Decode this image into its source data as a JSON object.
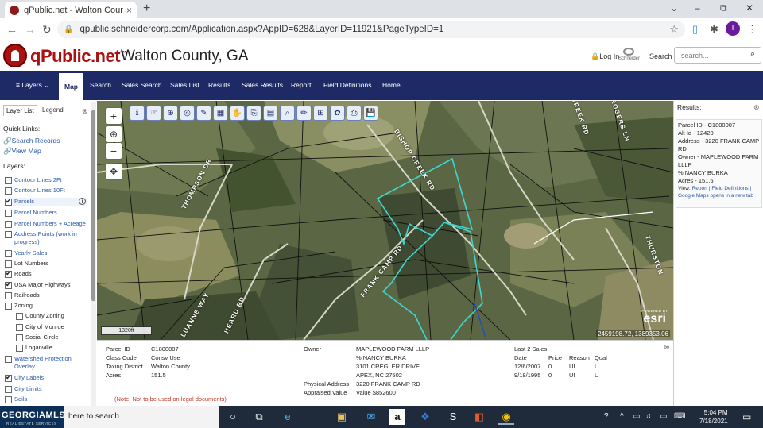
{
  "browser": {
    "tab_title": "qPublic.net - Walton County, GA",
    "tab_close": "×",
    "new_tab": "+",
    "url": "qpublic.schneidercorp.com/Application.aspx?AppID=628&LayerID=11921&PageTypeID=1",
    "profile_initial": "T",
    "window_controls": [
      "⌄",
      "–",
      "⧉",
      "✕"
    ]
  },
  "site": {
    "logo": "qPublic.net",
    "logo_tm": "™",
    "county": "Walton County, GA",
    "login": "Log In",
    "schneider": "Schneider",
    "search_label": "Search",
    "search_placeholder": "search..."
  },
  "nav": {
    "items": [
      "≡ Layers",
      "Map",
      "Search",
      "Sales Search",
      "Sales List",
      "Results",
      "Sales Results",
      "Report",
      "Field Definitions",
      "Home"
    ],
    "active": "Map"
  },
  "left_panel": {
    "tabs": [
      "Layer List",
      "Legend"
    ],
    "close": "⊗",
    "quick_links_title": "Quick Links:",
    "quick_links": [
      "Search Records",
      "View Map"
    ],
    "layers_title": "Layers:",
    "layers": [
      {
        "label": "Contour Lines 2Ft",
        "checked": false
      },
      {
        "label": "Contour Lines 10Ft",
        "checked": false
      },
      {
        "label": "Parcels",
        "checked": true
      },
      {
        "label": "Parcel Numbers",
        "checked": false
      },
      {
        "label": "Parcel Numbers + Acreage",
        "checked": false
      },
      {
        "label": "Address Points (work in progress)",
        "checked": false
      },
      {
        "label": "Yearly Sales",
        "checked": false
      },
      {
        "label": "Lot Numbers",
        "checked": false
      },
      {
        "label": "Roads",
        "checked": true
      },
      {
        "label": "USA Major Highways",
        "checked": true
      },
      {
        "label": "Railroads",
        "checked": false
      },
      {
        "label": "Zoning",
        "checked": false
      },
      {
        "label": "County Zoning",
        "checked": false
      },
      {
        "label": "City of Monroe",
        "checked": false
      },
      {
        "label": "Social Circle",
        "checked": false
      },
      {
        "label": "Loganville",
        "checked": false
      },
      {
        "label": "Watershed Protection Overlay",
        "checked": false
      },
      {
        "label": "City Labels",
        "checked": true
      },
      {
        "label": "City Limits",
        "checked": false
      },
      {
        "label": "Soils",
        "checked": false
      }
    ]
  },
  "map": {
    "controls": [
      "+",
      "⊕",
      "−",
      "✥"
    ],
    "tools": [
      "ℹ",
      "☞",
      "⊕",
      "◎",
      "✎",
      "▦",
      "✋",
      "⎘",
      "▤",
      "⌕",
      "✏",
      "⊞",
      "✿",
      "⎙",
      "💾"
    ],
    "scale": "1320ft",
    "esri_powered": "POWERED BY",
    "esri_logo": "esri",
    "coords": "2459198.72, 1389353.06",
    "road_labels": [
      "BISHOP CREEK RD",
      "FRANK CAMP RD",
      "THOMPSON DR",
      "LUANNE WAY",
      "HEARD RD",
      "GREEK RD",
      "ROGERS LN",
      "THURSTON"
    ]
  },
  "results": {
    "title": "Results:",
    "close": "⊗",
    "parcel_id": "Parcel ID - C1800007",
    "alt_id": "Alt Id - 12420",
    "address": "Address - 3220 FRANK CAMP RD",
    "owner": "Owner - MAPLEWOOD FARM LLLP",
    "owner2": "% NANCY BURKA",
    "acres": "Acres - 151.5",
    "view": "View:",
    "link_report": "Report",
    "link_field": "Field Definitions",
    "link_gmaps": "Google Maps opens in a new tab"
  },
  "parcel_info": {
    "labels": [
      "Parcel ID",
      "Class Code",
      "Taxing District",
      "Acres"
    ],
    "values": [
      "C1800007",
      "Consv Use",
      "Walton County",
      "151.5"
    ],
    "owner_label": "Owner",
    "owner_lines": [
      "MAPLEWOOD FARM LLLP",
      "% NANCY BURKA",
      "3101 CREGLER DRIVE",
      "APEX, NC 27502"
    ],
    "physical_label": "Physical Address",
    "physical": "3220 FRANK CAMP RD",
    "appraised_label": "Appraised Value",
    "appraised": "Value $852600",
    "sales_title": "Last 2 Sales",
    "sales_headers": [
      "Date",
      "Price",
      "Reason",
      "Qual"
    ],
    "sales": [
      [
        "12/6/2007",
        "0",
        "UI",
        "U"
      ],
      [
        "9/18/1995",
        "0",
        "UI",
        "U"
      ]
    ],
    "note": "(Note: Not to be used on legal documents)",
    "close": "⊗"
  },
  "taskbar": {
    "brand": "GEORGIAMLS",
    "brand_sub": "REAL ESTATE SERVICES",
    "search_text": "here to search",
    "icons": [
      "○",
      "⧉",
      "e",
      "▣",
      "✉",
      "a",
      "❖",
      "S",
      "◧",
      "◉"
    ],
    "tray": [
      "?",
      "^",
      "▭",
      "♫",
      "▭",
      "⌨"
    ],
    "time": "5:04 PM",
    "date": "7/18/2021",
    "notifications": "▭"
  }
}
